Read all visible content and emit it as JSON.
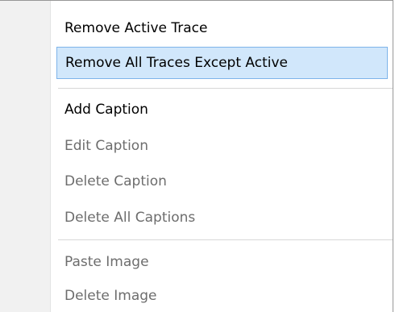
{
  "menu": {
    "items": [
      {
        "label": "Remove Active Trace",
        "enabled": true
      },
      {
        "label": "Remove All Traces Except Active",
        "enabled": true,
        "highlighted": true
      },
      {
        "label": "Add Caption",
        "enabled": true
      },
      {
        "label": "Edit Caption",
        "enabled": false
      },
      {
        "label": "Delete Caption",
        "enabled": false
      },
      {
        "label": "Delete All Captions",
        "enabled": false
      },
      {
        "label": "Paste Image",
        "enabled": false
      },
      {
        "label": "Delete Image",
        "enabled": false
      }
    ]
  },
  "colors": {
    "highlight_fill": "#d1e7fb",
    "highlight_border": "#7eb4ea",
    "disabled_text": "#6d6d6d",
    "enabled_text": "#000000"
  }
}
